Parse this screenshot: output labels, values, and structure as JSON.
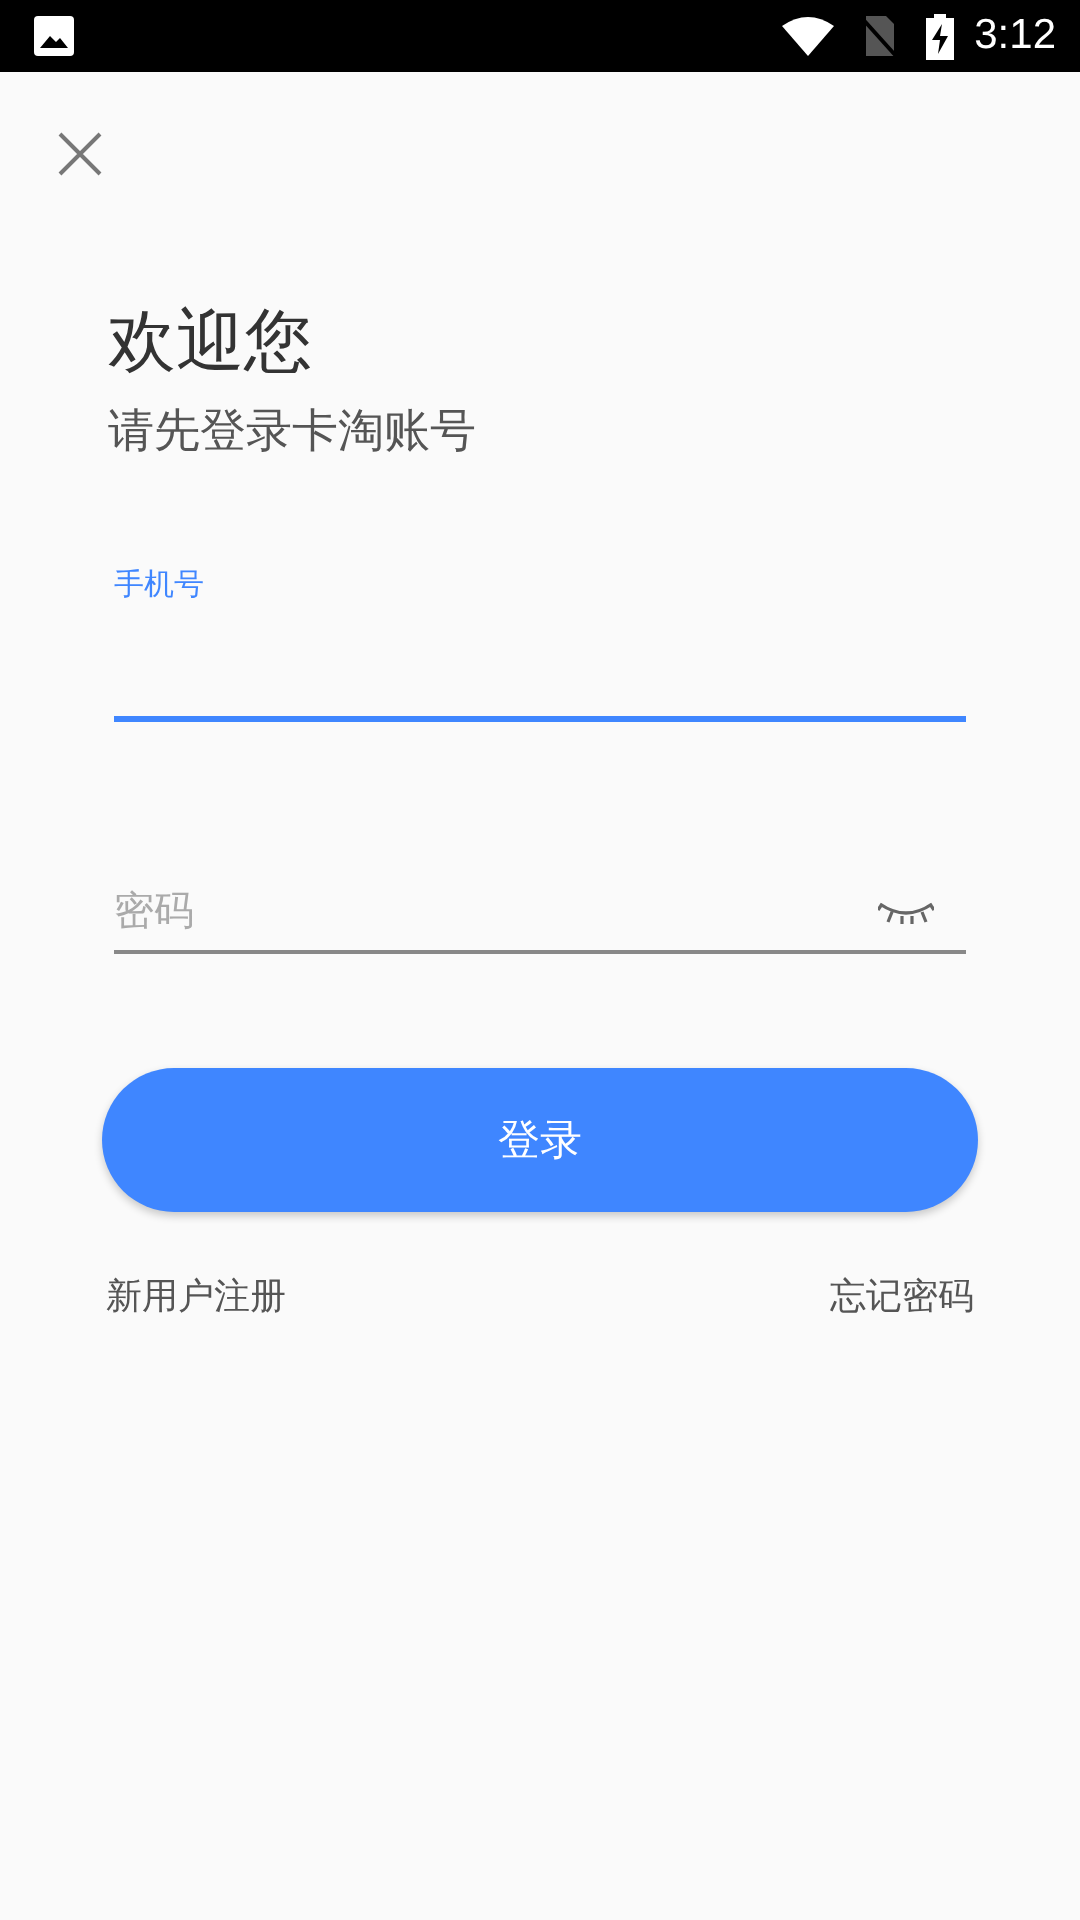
{
  "status_bar": {
    "time": "3:12"
  },
  "heading": {
    "title": "欢迎您",
    "subtitle": "请先登录卡淘账号"
  },
  "fields": [
    {
      "kind": "phone",
      "label": "手机号",
      "focused": true
    },
    {
      "kind": "password",
      "placeholder": "密码",
      "focused": false
    }
  ],
  "login_button": {
    "label": "登录"
  },
  "links": [
    {
      "label": "新用户注册"
    },
    {
      "label": "忘记密码"
    }
  ]
}
